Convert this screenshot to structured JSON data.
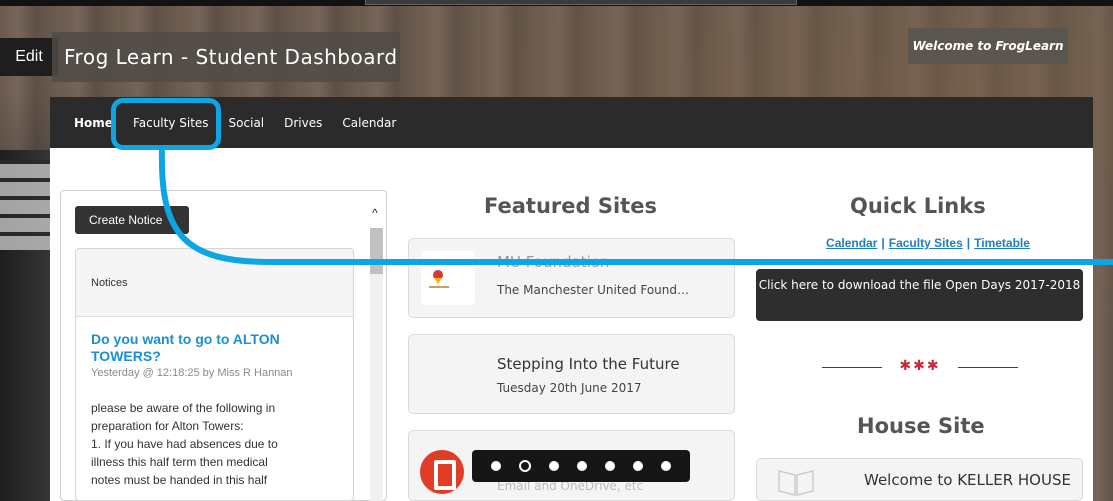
{
  "header": {
    "edit_label": "Edit",
    "title": "Frog Learn - Student Dashboard",
    "welcome": "Welcome to FrogLearn"
  },
  "nav": {
    "items": [
      {
        "label": "Home",
        "active": true
      },
      {
        "label": "Faculty Sites",
        "active": false
      },
      {
        "label": "Social",
        "active": false
      },
      {
        "label": "Drives",
        "active": false
      },
      {
        "label": "Calendar",
        "active": false
      }
    ]
  },
  "notices": {
    "create_label": "Create Notice",
    "panel_title": "Notices",
    "item": {
      "title": "Do you want to go to ALTON TOWERS?",
      "meta": "Yesterday @ 12:18:25 by Miss R Hannan",
      "body": [
        "please be aware of the following in",
        "preparation for Alton Towers:",
        "1. If you have had absences due to",
        "illness this half term then medical",
        "notes must be handed in this half"
      ]
    }
  },
  "featured": {
    "heading": "Featured Sites",
    "cards": [
      {
        "title": "MU Foundation",
        "subtitle": "The Manchester United Found…"
      },
      {
        "title": "Stepping Into the Future",
        "subtitle": "Tuesday 20th June 2017"
      },
      {
        "title": "Email and OneDrive, etc",
        "subtitle": ""
      }
    ]
  },
  "quick_links": {
    "heading": "Quick Links",
    "links": [
      "Calendar",
      "Faculty Sites",
      "Timetable"
    ],
    "download_label": "Click here to download the file Open Days 2017-2018",
    "house_heading": "House Site",
    "house_card_title": "Welcome to KELLER HOUSE"
  },
  "carousel": {
    "dots": 7,
    "current_index": 1
  },
  "colors": {
    "accent": "#0ea6e2",
    "link": "#1a7fc3",
    "notice_title": "#1a8fd6",
    "nav_bg": "#2b2b2b"
  }
}
